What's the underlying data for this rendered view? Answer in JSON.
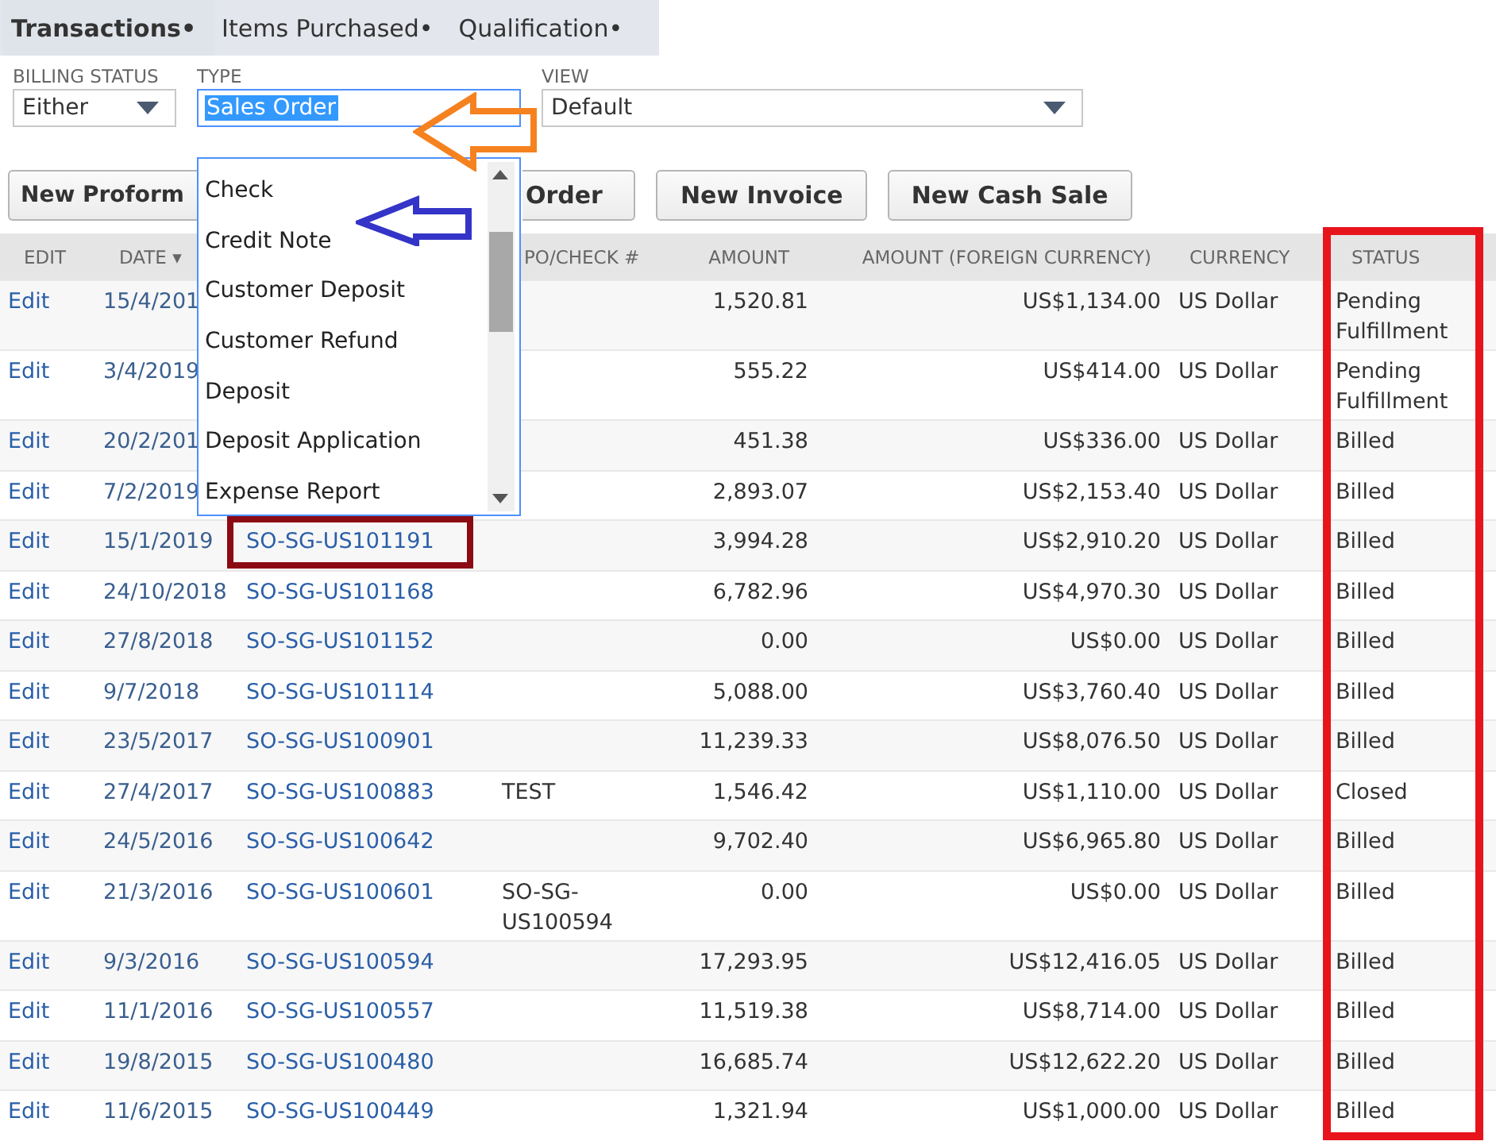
{
  "tabs": [
    {
      "label": "Transactions•",
      "selected": true
    },
    {
      "label": "Items Purchased•",
      "selected": false
    },
    {
      "label": "Qualification•",
      "selected": false
    }
  ],
  "filters": [
    {
      "label": "BILLING STATUS",
      "value": "Either",
      "focused": false,
      "expanded": false
    },
    {
      "label": "TYPE",
      "value": "Sales Order",
      "focused": true,
      "expanded": true,
      "options": [
        "Check",
        "Credit Note",
        "Customer Deposit",
        "Customer Refund",
        "Deposit",
        "Deposit Application",
        "Expense Report"
      ]
    },
    {
      "label": "VIEW",
      "value": "Default",
      "focused": false,
      "expanded": false
    }
  ],
  "buttons": [
    "New Proform",
    "Order",
    "New Invoice",
    "New Cash Sale"
  ],
  "table": {
    "columns": [
      "EDIT",
      "DATE ▾",
      "",
      "PO/CHECK #",
      "AMOUNT",
      "AMOUNT (FOREIGN CURRENCY)",
      "CURRENCY",
      "STATUS"
    ],
    "rows": [
      {
        "edit": "Edit",
        "date": "15/4/201",
        "number": "",
        "po": "",
        "amount": "1,520.81",
        "foreign": "US$1,134.00",
        "currency": "US Dollar",
        "status": "Pending Fulfillment"
      },
      {
        "edit": "Edit",
        "date": "3/4/2019",
        "number": "",
        "po": "",
        "amount": "555.22",
        "foreign": "US$414.00",
        "currency": "US Dollar",
        "status": "Pending Fulfillment"
      },
      {
        "edit": "Edit",
        "date": "20/2/201",
        "number": "",
        "po": "",
        "amount": "451.38",
        "foreign": "US$336.00",
        "currency": "US Dollar",
        "status": "Billed"
      },
      {
        "edit": "Edit",
        "date": "7/2/2019",
        "number": "",
        "po": "",
        "amount": "2,893.07",
        "foreign": "US$2,153.40",
        "currency": "US Dollar",
        "status": "Billed"
      },
      {
        "edit": "Edit",
        "date": "15/1/2019",
        "number": "SO-SG-US101191",
        "po": "",
        "amount": "3,994.28",
        "foreign": "US$2,910.20",
        "currency": "US Dollar",
        "status": "Billed"
      },
      {
        "edit": "Edit",
        "date": "24/10/2018",
        "number": "SO-SG-US101168",
        "po": "",
        "amount": "6,782.96",
        "foreign": "US$4,970.30",
        "currency": "US Dollar",
        "status": "Billed"
      },
      {
        "edit": "Edit",
        "date": "27/8/2018",
        "number": "SO-SG-US101152",
        "po": "",
        "amount": "0.00",
        "foreign": "US$0.00",
        "currency": "US Dollar",
        "status": "Billed"
      },
      {
        "edit": "Edit",
        "date": "9/7/2018",
        "number": "SO-SG-US101114",
        "po": "",
        "amount": "5,088.00",
        "foreign": "US$3,760.40",
        "currency": "US Dollar",
        "status": "Billed"
      },
      {
        "edit": "Edit",
        "date": "23/5/2017",
        "number": "SO-SG-US100901",
        "po": "",
        "amount": "11,239.33",
        "foreign": "US$8,076.50",
        "currency": "US Dollar",
        "status": "Billed"
      },
      {
        "edit": "Edit",
        "date": "27/4/2017",
        "number": "SO-SG-US100883",
        "po": "TEST",
        "amount": "1,546.42",
        "foreign": "US$1,110.00",
        "currency": "US Dollar",
        "status": "Closed"
      },
      {
        "edit": "Edit",
        "date": "24/5/2016",
        "number": "SO-SG-US100642",
        "po": "",
        "amount": "9,702.40",
        "foreign": "US$6,965.80",
        "currency": "US Dollar",
        "status": "Billed"
      },
      {
        "edit": "Edit",
        "date": "21/3/2016",
        "number": "SO-SG-US100601",
        "po": "SO-SG-US100594",
        "amount": "0.00",
        "foreign": "US$0.00",
        "currency": "US Dollar",
        "status": "Billed"
      },
      {
        "edit": "Edit",
        "date": "9/3/2016",
        "number": "SO-SG-US100594",
        "po": "",
        "amount": "17,293.95",
        "foreign": "US$12,416.05",
        "currency": "US Dollar",
        "status": "Billed"
      },
      {
        "edit": "Edit",
        "date": "11/1/2016",
        "number": "SO-SG-US100557",
        "po": "",
        "amount": "11,519.38",
        "foreign": "US$8,714.00",
        "currency": "US Dollar",
        "status": "Billed"
      },
      {
        "edit": "Edit",
        "date": "19/8/2015",
        "number": "SO-SG-US100480",
        "po": "",
        "amount": "16,685.74",
        "foreign": "US$12,622.20",
        "currency": "US Dollar",
        "status": "Billed"
      },
      {
        "edit": "Edit",
        "date": "11/6/2015",
        "number": "SO-SG-US100449",
        "po": "",
        "amount": "1,321.94",
        "foreign": "US$1,000.00",
        "currency": "US Dollar",
        "status": "Billed"
      }
    ]
  }
}
